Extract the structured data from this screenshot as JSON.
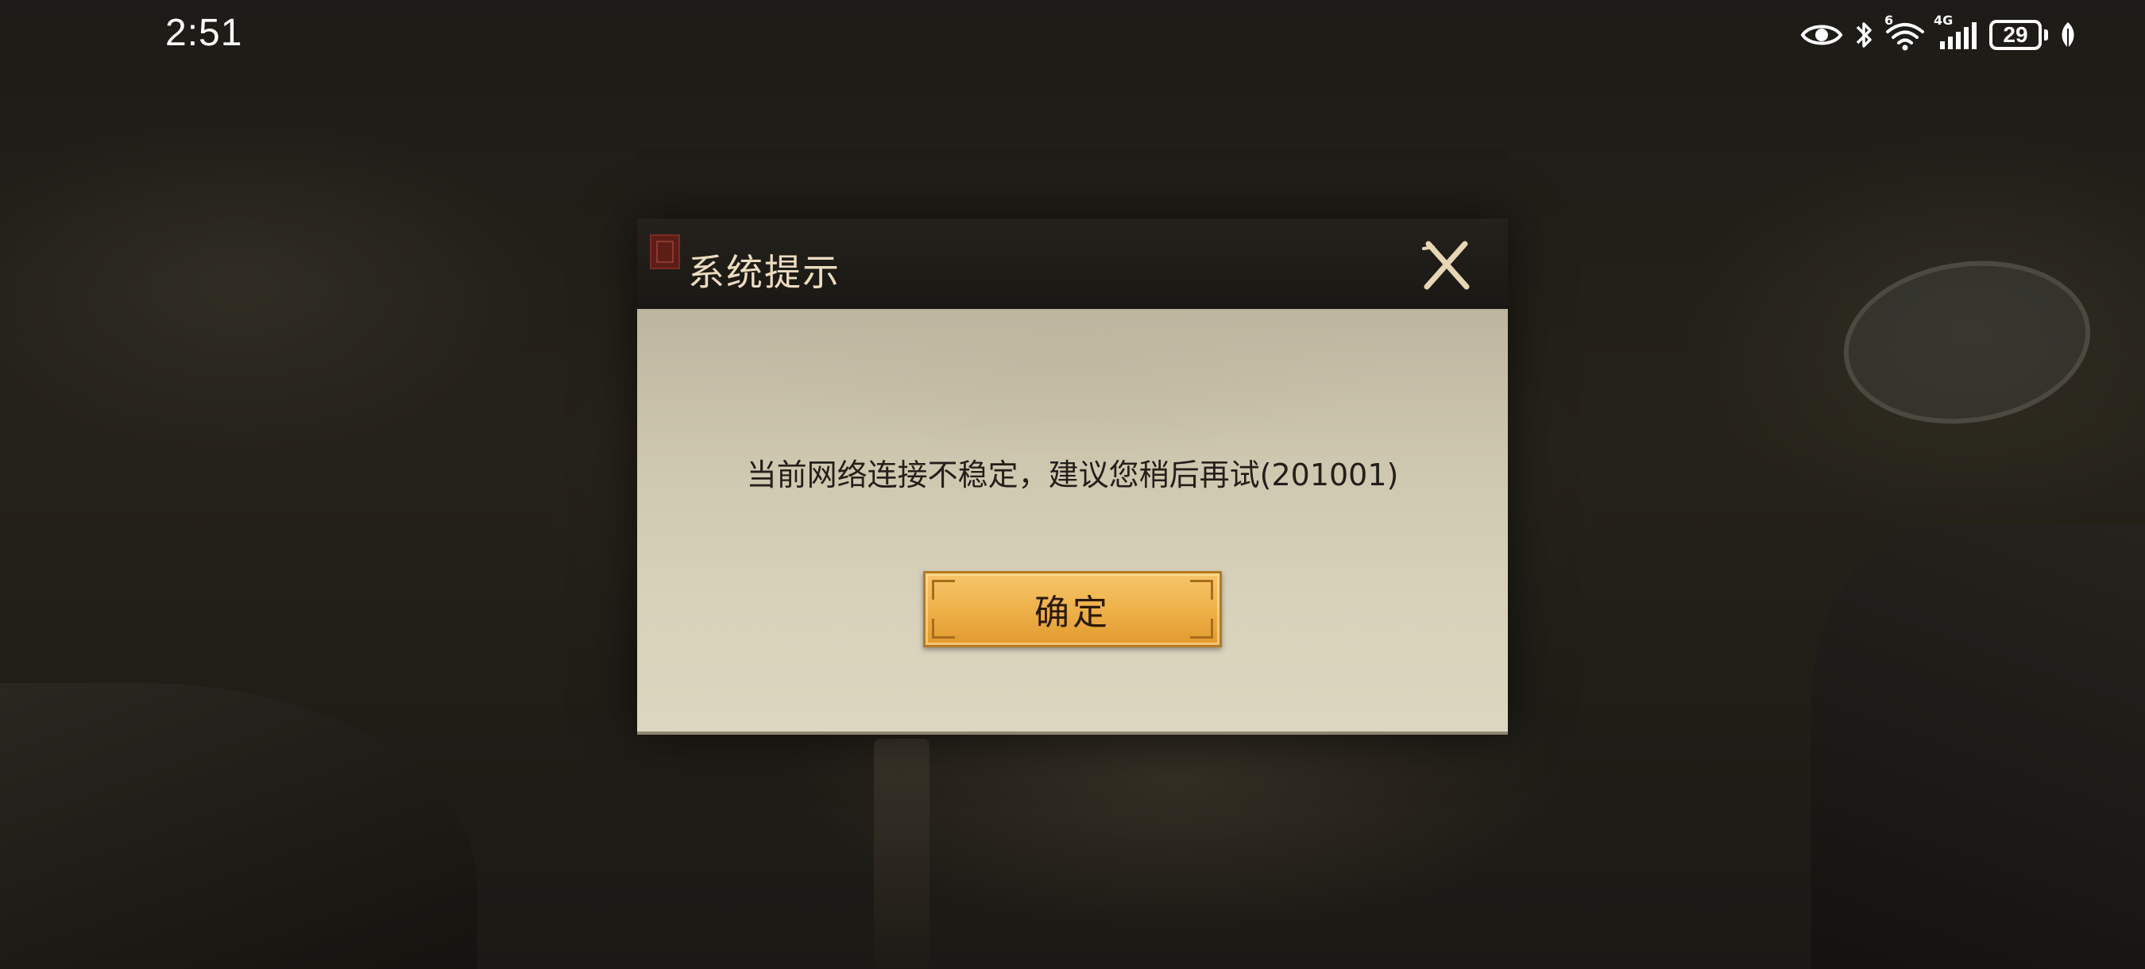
{
  "status_bar": {
    "time": "2:51",
    "icons": [
      "eye-icon",
      "bluetooth-icon",
      "wifi-icon",
      "cellular-signal-icon",
      "battery-icon",
      "leaf-icon"
    ],
    "wifi_badge": "6",
    "network_type": "4G",
    "battery_level": "29"
  },
  "dialog": {
    "title": "系统提示",
    "message": "当前网络连接不稳定，建议您稍后再试(201001)",
    "confirm_label": "确定",
    "close_icon": "close-icon"
  },
  "colors": {
    "header_bg": "#1a1814",
    "title_text": "#ecdcc0",
    "body_bg": "#d8d2bb",
    "button_gold": "#eeaf47",
    "message_text": "#231f1a"
  }
}
